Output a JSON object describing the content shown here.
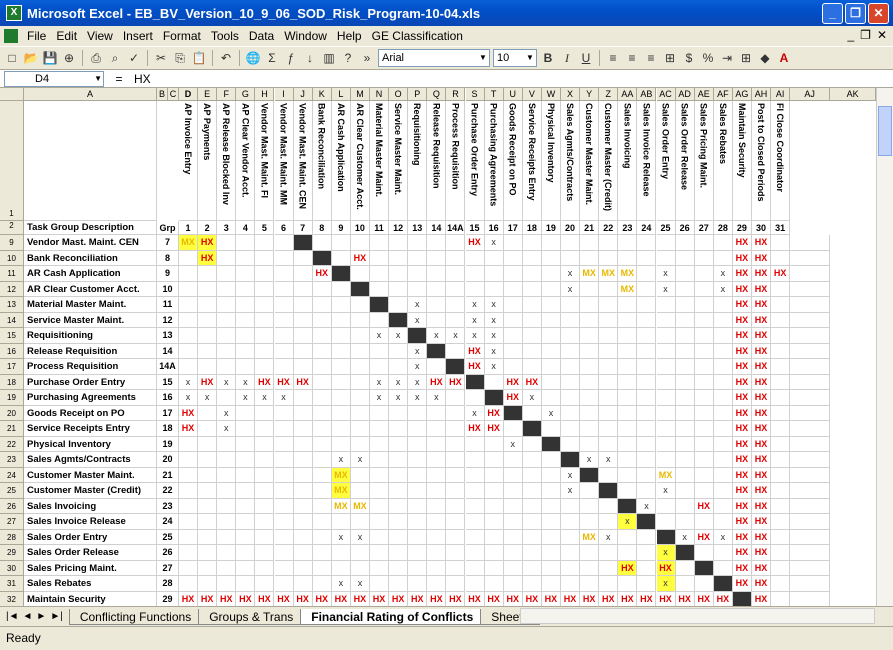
{
  "window": {
    "title": "Microsoft Excel - EB_BV_Version_10_9_06_SOD_Risk_Program-10-04.xls"
  },
  "menu": [
    "File",
    "Edit",
    "View",
    "Insert",
    "Format",
    "Tools",
    "Data",
    "Window",
    "Help",
    "GE Classification"
  ],
  "toolbar": {
    "font": "Arial",
    "size": "10"
  },
  "formula": {
    "namebox": "D4",
    "eq": "=",
    "value": "HX"
  },
  "colLetters": [
    "A",
    "B",
    "C",
    "D",
    "E",
    "F",
    "G",
    "H",
    "I",
    "J",
    "K",
    "L",
    "M",
    "N",
    "O",
    "P",
    "Q",
    "R",
    "S",
    "T",
    "U",
    "V",
    "W",
    "X",
    "Y",
    "Z",
    "AA",
    "AB",
    "AC",
    "AD",
    "AE",
    "AF",
    "AG",
    "AH",
    "AI",
    "AJ",
    "AK"
  ],
  "functions": [
    "AP Invoice Entry",
    "AP Payments",
    "AP Release Blocked Inv",
    "AP Clear Vendor Acct.",
    "Vendor Mast. Maint. FI",
    "Vendor Mast. Maint. MM",
    "Vendor Mast. Maint. CEN",
    "Bank Reconciliation",
    "AR Cash Application",
    "AR Clear Customer Acct.",
    "Material Master Maint.",
    "Service Master Maint.",
    "Requisitioning",
    "Release Requisition",
    "Process Requisition",
    "Purchase Order Entry",
    "Purchasing Agreements",
    "Goods Receipt on PO",
    "Service Receipts Entry",
    "Physical Inventory",
    "Sales Agmts/Contracts",
    "Customer Master Maint.",
    "Customer Master (Credit)",
    "Sales Invoicing",
    "Sales Invoice Release",
    "Sales Order Entry",
    "Sales Order Release",
    "Sales Pricing Maint.",
    "Sales Rebates",
    "Maintain Security",
    "Post to Closed Periods",
    "FI Close Coordinator"
  ],
  "header": {
    "rownum": "2",
    "desc": "Task Group Description",
    "grp": "Grp",
    "nums": [
      "1",
      "2",
      "3",
      "4",
      "5",
      "6",
      "7",
      "8",
      "9",
      "10",
      "11",
      "12",
      "13",
      "14",
      "14A",
      "15",
      "16",
      "17",
      "18",
      "19",
      "20",
      "21",
      "22",
      "23",
      "24",
      "25",
      "26",
      "27",
      "28",
      "29",
      "30",
      "31"
    ]
  },
  "rows": [
    {
      "n": "9",
      "desc": "Vendor Mast. Maint. CEN",
      "grp": "7",
      "cells": [
        "MX*",
        "HX*",
        "",
        "",
        "",
        "",
        "#",
        "",
        "",
        "",
        "",
        "",
        "",
        "",
        "",
        "HX",
        "X",
        "",
        "",
        "",
        "",
        "",
        "",
        "",
        "",
        "",
        "",
        "",
        "",
        "HX",
        "HX",
        ""
      ]
    },
    {
      "n": "10",
      "desc": "Bank Reconciliation",
      "grp": "8",
      "cells": [
        "",
        "HX*",
        "",
        "",
        "",
        "",
        "",
        "#",
        "",
        "HX",
        "",
        "",
        "",
        "",
        "",
        "",
        "",
        "",
        "",
        "",
        "",
        "",
        "",
        "",
        "",
        "",
        "",
        "",
        "",
        "HX",
        "HX",
        ""
      ]
    },
    {
      "n": "11",
      "desc": "AR Cash Application",
      "grp": "9",
      "cells": [
        "",
        "",
        "",
        "",
        "",
        "",
        "",
        "HX",
        "#",
        "",
        "",
        "",
        "",
        "",
        "",
        "",
        "",
        "",
        "",
        "",
        "X",
        "MX",
        "MX",
        "MX",
        "",
        "X",
        "",
        "",
        "X",
        "HX",
        "HX",
        "HX"
      ]
    },
    {
      "n": "12",
      "desc": "AR Clear Customer Acct.",
      "grp": "10",
      "cells": [
        "",
        "",
        "",
        "",
        "",
        "",
        "",
        "",
        "",
        "#",
        "",
        "",
        "",
        "",
        "",
        "",
        "",
        "",
        "",
        "",
        "X",
        "",
        "",
        "MX",
        "",
        "X",
        "",
        "",
        "X",
        "HX",
        "HX",
        ""
      ]
    },
    {
      "n": "13",
      "desc": "Material Master Maint.",
      "grp": "11",
      "cells": [
        "",
        "",
        "",
        "",
        "",
        "",
        "",
        "",
        "",
        "",
        "#",
        "",
        "X",
        "",
        "",
        "X",
        "X",
        "",
        "",
        "",
        "",
        "",
        "",
        "",
        "",
        "",
        "",
        "",
        "",
        "HX",
        "HX",
        ""
      ]
    },
    {
      "n": "14",
      "desc": "Service Master Maint.",
      "grp": "12",
      "cells": [
        "",
        "",
        "",
        "",
        "",
        "",
        "",
        "",
        "",
        "",
        "",
        "#",
        "X",
        "",
        "",
        "X",
        "X",
        "",
        "",
        "",
        "",
        "",
        "",
        "",
        "",
        "",
        "",
        "",
        "",
        "HX",
        "HX",
        ""
      ]
    },
    {
      "n": "15",
      "desc": "Requisitioning",
      "grp": "13",
      "cells": [
        "",
        "",
        "",
        "",
        "",
        "",
        "",
        "",
        "",
        "",
        "X",
        "X",
        "#",
        "X",
        "X",
        "X",
        "X",
        "",
        "",
        "",
        "",
        "",
        "",
        "",
        "",
        "",
        "",
        "",
        "",
        "HX",
        "HX",
        ""
      ]
    },
    {
      "n": "16",
      "desc": "Release Requisition",
      "grp": "14",
      "cells": [
        "",
        "",
        "",
        "",
        "",
        "",
        "",
        "",
        "",
        "",
        "",
        "",
        "X",
        "#",
        "",
        "HX",
        "X",
        "",
        "",
        "",
        "",
        "",
        "",
        "",
        "",
        "",
        "",
        "",
        "",
        "HX",
        "HX",
        ""
      ]
    },
    {
      "n": "17",
      "desc": "Process Requisition",
      "grp": "14A",
      "cells": [
        "",
        "",
        "",
        "",
        "",
        "",
        "",
        "",
        "",
        "",
        "",
        "",
        "X",
        "",
        "#",
        "HX",
        "X",
        "",
        "",
        "",
        "",
        "",
        "",
        "",
        "",
        "",
        "",
        "",
        "",
        "HX",
        "HX",
        ""
      ]
    },
    {
      "n": "18",
      "desc": "Purchase Order Entry",
      "grp": "15",
      "cells": [
        "X",
        "HX",
        "X",
        "X",
        "HX",
        "HX",
        "HX",
        "",
        "",
        "",
        "X",
        "X",
        "X",
        "HX",
        "HX",
        "#",
        "",
        "HX",
        "HX",
        "",
        "",
        "",
        "",
        "",
        "",
        "",
        "",
        "",
        "",
        "HX",
        "HX",
        ""
      ]
    },
    {
      "n": "19",
      "desc": "Purchasing Agreements",
      "grp": "16",
      "cells": [
        "X",
        "X",
        "",
        "X",
        "X",
        "X",
        "",
        "",
        "",
        "",
        "X",
        "X",
        "X",
        "X",
        "",
        "",
        "#",
        "HX",
        "X",
        "",
        "",
        "",
        "",
        "",
        "",
        "",
        "",
        "",
        "",
        "HX",
        "HX",
        ""
      ]
    },
    {
      "n": "20",
      "desc": "Goods Receipt on PO",
      "grp": "17",
      "cells": [
        "HX",
        "",
        "X",
        "",
        "",
        "",
        "",
        "",
        "",
        "",
        "",
        "",
        "",
        "",
        "",
        "X",
        "HX",
        "#",
        "",
        "X",
        "",
        "",
        "",
        "",
        "",
        "",
        "",
        "",
        "",
        "HX",
        "HX",
        ""
      ]
    },
    {
      "n": "21",
      "desc": "Service Receipts Entry",
      "grp": "18",
      "cells": [
        "HX",
        "",
        "X",
        "",
        "",
        "",
        "",
        "",
        "",
        "",
        "",
        "",
        "",
        "",
        "",
        "HX",
        "HX",
        "",
        "#",
        "",
        "",
        "",
        "",
        "",
        "",
        "",
        "",
        "",
        "",
        "HX",
        "HX",
        ""
      ]
    },
    {
      "n": "22",
      "desc": "Physical Inventory",
      "grp": "19",
      "cells": [
        "",
        "",
        "",
        "",
        "",
        "",
        "",
        "",
        "",
        "",
        "",
        "",
        "",
        "",
        "",
        "",
        "",
        "X",
        "",
        "#",
        "",
        "",
        "",
        "",
        "",
        "",
        "",
        "",
        "",
        "HX",
        "HX",
        ""
      ]
    },
    {
      "n": "23",
      "desc": "Sales Agmts/Contracts",
      "grp": "20",
      "cells": [
        "",
        "",
        "",
        "",
        "",
        "",
        "",
        "",
        "X",
        "X",
        "",
        "",
        "",
        "",
        "",
        "",
        "",
        "",
        "",
        "",
        "#",
        "X",
        "X",
        "",
        "",
        "",
        "",
        "",
        "",
        "HX",
        "HX",
        ""
      ]
    },
    {
      "n": "24",
      "desc": "Customer Master Maint.",
      "grp": "21",
      "cells": [
        "",
        "",
        "",
        "",
        "",
        "",
        "",
        "",
        "MX*",
        "",
        "",
        "",
        "",
        "",
        "",
        "",
        "",
        "",
        "",
        "",
        "X",
        "#",
        "",
        "",
        "",
        "MX",
        "",
        "",
        "",
        "HX",
        "HX",
        ""
      ]
    },
    {
      "n": "25",
      "desc": "Customer Master (Credit)",
      "grp": "22",
      "cells": [
        "",
        "",
        "",
        "",
        "",
        "",
        "",
        "",
        "MX*",
        "",
        "",
        "",
        "",
        "",
        "",
        "",
        "",
        "",
        "",
        "",
        "X",
        "",
        "#",
        "",
        "",
        "X",
        "",
        "",
        "",
        "HX",
        "HX",
        ""
      ]
    },
    {
      "n": "26",
      "desc": "Sales Invoicing",
      "grp": "23",
      "cells": [
        "",
        "",
        "",
        "",
        "",
        "",
        "",
        "",
        "MX",
        "MX",
        "",
        "",
        "",
        "",
        "",
        "",
        "",
        "",
        "",
        "",
        "",
        "",
        "",
        "#",
        "X",
        "",
        "",
        "HX",
        "",
        "HX",
        "HX",
        ""
      ]
    },
    {
      "n": "27",
      "desc": "Sales Invoice Release",
      "grp": "24",
      "cells": [
        "",
        "",
        "",
        "",
        "",
        "",
        "",
        "",
        "",
        "",
        "",
        "",
        "",
        "",
        "",
        "",
        "",
        "",
        "",
        "",
        "",
        "",
        "",
        "X*",
        "#",
        "",
        "",
        "",
        "",
        "HX",
        "HX",
        ""
      ]
    },
    {
      "n": "28",
      "desc": "Sales Order Entry",
      "grp": "25",
      "cells": [
        "",
        "",
        "",
        "",
        "",
        "",
        "",
        "",
        "X",
        "X",
        "",
        "",
        "",
        "",
        "",
        "",
        "",
        "",
        "",
        "",
        "",
        "MX",
        "X",
        "",
        "",
        "#",
        "X",
        "HX",
        "X",
        "HX",
        "HX",
        ""
      ]
    },
    {
      "n": "29",
      "desc": "Sales Order Release",
      "grp": "26",
      "cells": [
        "",
        "",
        "",
        "",
        "",
        "",
        "",
        "",
        "",
        "",
        "",
        "",
        "",
        "",
        "",
        "",
        "",
        "",
        "",
        "",
        "",
        "",
        "",
        "",
        "",
        "X*",
        "#",
        "",
        "",
        "HX",
        "HX",
        ""
      ]
    },
    {
      "n": "30",
      "desc": "Sales Pricing Maint.",
      "grp": "27",
      "cells": [
        "",
        "",
        "",
        "",
        "",
        "",
        "",
        "",
        "",
        "",
        "",
        "",
        "",
        "",
        "",
        "",
        "",
        "",
        "",
        "",
        "",
        "",
        "",
        "HX*",
        "",
        "HX*",
        "",
        "#",
        "",
        "HX",
        "HX",
        ""
      ]
    },
    {
      "n": "31",
      "desc": "Sales Rebates",
      "grp": "28",
      "cells": [
        "",
        "",
        "",
        "",
        "",
        "",
        "",
        "",
        "X",
        "X",
        "",
        "",
        "",
        "",
        "",
        "",
        "",
        "",
        "",
        "",
        "",
        "",
        "",
        "",
        "",
        "X*",
        "",
        "",
        "#",
        "HX",
        "HX",
        ""
      ]
    },
    {
      "n": "32",
      "desc": "Maintain Security",
      "grp": "29",
      "cells": [
        "HX",
        "HX",
        "HX",
        "HX",
        "HX",
        "HX",
        "HX",
        "HX",
        "HX",
        "HX",
        "HX",
        "HX",
        "HX",
        "HX",
        "HX",
        "HX",
        "HX",
        "HX",
        "HX",
        "HX",
        "HX",
        "HX",
        "HX",
        "HX",
        "HX",
        "HX",
        "HX",
        "HX",
        "HX",
        "#",
        "HX",
        ""
      ]
    }
  ],
  "sheetTabs": [
    "Conflicting Functions",
    "Groups & Trans",
    "Financial Rating of Conflicts",
    "Sheet3"
  ],
  "activeTab": 2,
  "status": "Ready"
}
